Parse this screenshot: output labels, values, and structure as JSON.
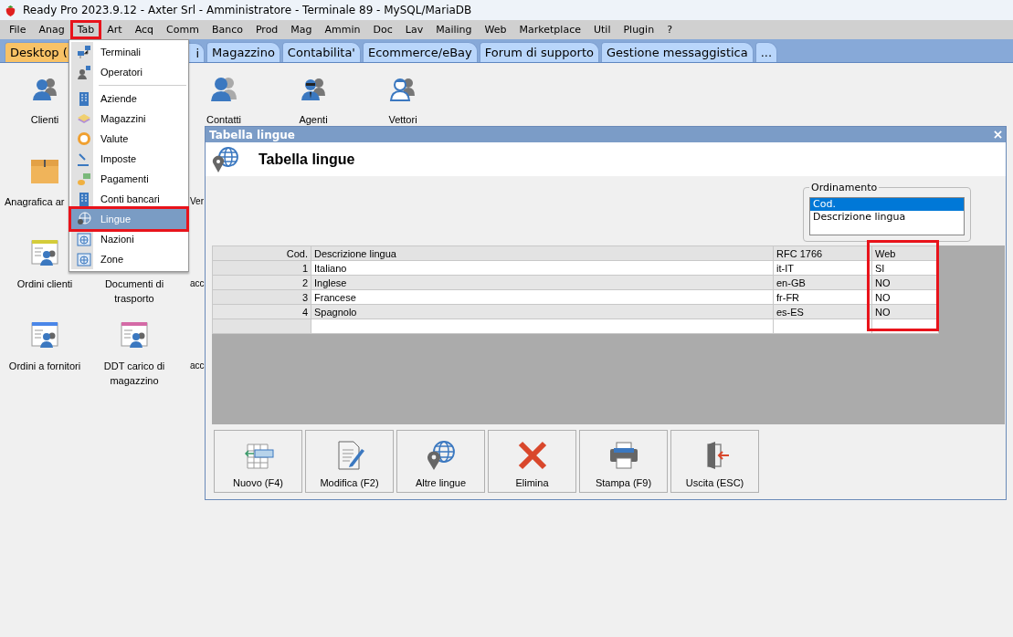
{
  "window": {
    "title": "Ready Pro 2023.9.12 - Axter Srl - Amministratore - Terminale 89 - MySQL/MariaDB"
  },
  "menu_bar": [
    {
      "label": "File",
      "highlighted": false
    },
    {
      "label": "Anag",
      "highlighted": false
    },
    {
      "label": "Tab",
      "highlighted": true
    },
    {
      "label": "Art",
      "highlighted": false
    },
    {
      "label": "Acq",
      "highlighted": false
    },
    {
      "label": "Comm",
      "highlighted": false
    },
    {
      "label": "Banco",
      "highlighted": false
    },
    {
      "label": "Prod",
      "highlighted": false
    },
    {
      "label": "Mag",
      "highlighted": false
    },
    {
      "label": "Ammin",
      "highlighted": false
    },
    {
      "label": "Doc",
      "highlighted": false
    },
    {
      "label": "Lav",
      "highlighted": false
    },
    {
      "label": "Mailing",
      "highlighted": false
    },
    {
      "label": "Web",
      "highlighted": false
    },
    {
      "label": "Marketplace",
      "highlighted": false
    },
    {
      "label": "Util",
      "highlighted": false
    },
    {
      "label": "Plugin",
      "highlighted": false
    },
    {
      "label": "?",
      "highlighted": false
    }
  ],
  "tabs": [
    {
      "label": "Desktop (",
      "selected": true
    },
    {
      "label": "i",
      "selected": false
    },
    {
      "label": "Magazzino",
      "selected": false
    },
    {
      "label": "Contabilita'",
      "selected": false
    },
    {
      "label": "Ecommerce/eBay",
      "selected": false
    },
    {
      "label": "Forum di supporto",
      "selected": false
    },
    {
      "label": "Gestione messaggistica",
      "selected": false
    },
    {
      "label": "...",
      "selected": false
    }
  ],
  "desktop": {
    "rows": [
      [
        {
          "label": "Clienti",
          "kind": "person"
        },
        null,
        {
          "label": "Contatti",
          "kind": "contacts"
        },
        {
          "label": "Agenti",
          "kind": "agent"
        },
        {
          "label": "Vettori",
          "kind": "courier"
        }
      ],
      [
        {
          "label": "Anagrafica ar",
          "kind": "box"
        },
        null,
        {
          "label": "Ver"
        },
        null,
        null
      ],
      [
        {
          "label": "Ordini clienti",
          "kind": "doc",
          "color": "#d4cc3a"
        },
        {
          "label": "Documenti di trasporto"
        },
        {
          "label": "acc"
        },
        null,
        null
      ],
      [
        {
          "label": "Ordini a fornitori",
          "kind": "doc",
          "color": "#4a86e8"
        },
        {
          "label": "DDT carico di magazzino",
          "kind": "doc",
          "color": "#d46aa6"
        },
        {
          "label": "acc"
        },
        null,
        null
      ]
    ]
  },
  "dropdown_menu": {
    "items": [
      {
        "label": "Terminali",
        "kind": "network",
        "selected": false,
        "highlighted": false
      },
      {
        "label": "Operatori",
        "kind": "operator",
        "selected": false,
        "highlighted": false
      },
      {
        "kind": "separator"
      },
      {
        "label": "Aziende",
        "kind": "building",
        "selected": false,
        "highlighted": false
      },
      {
        "label": "Magazzini",
        "kind": "stack",
        "selected": false,
        "highlighted": false
      },
      {
        "label": "Valute",
        "kind": "coin",
        "selected": false,
        "highlighted": false
      },
      {
        "label": "Imposte",
        "kind": "gavel",
        "selected": false,
        "highlighted": false
      },
      {
        "label": "Pagamenti",
        "kind": "money",
        "selected": false,
        "highlighted": false
      },
      {
        "label": "Conti bancari",
        "kind": "building",
        "selected": false,
        "highlighted": false
      },
      {
        "label": "Lingue",
        "kind": "globe",
        "selected": true,
        "highlighted": true
      },
      {
        "label": "Nazioni",
        "kind": "globe-window",
        "selected": false,
        "highlighted": false
      },
      {
        "label": "Zone",
        "kind": "globe-window",
        "selected": false,
        "highlighted": false
      }
    ]
  },
  "dialog": {
    "title": "Tabella lingue",
    "heading": "Tabella lingue",
    "sort_group": {
      "label": "Ordinamento",
      "options": [
        {
          "label": "Cod.",
          "selected": true
        },
        {
          "label": "Descrizione lingua",
          "selected": false
        }
      ]
    },
    "table": {
      "columns": [
        {
          "label": "Cod.",
          "highlighted": false
        },
        {
          "label": "Descrizione lingua",
          "highlighted": false
        },
        {
          "label": "RFC 1766",
          "highlighted": false
        },
        {
          "label": "Web",
          "highlighted": true
        }
      ],
      "rows": [
        [
          "1",
          "Italiano",
          "it-IT",
          "SI"
        ],
        [
          "2",
          "Inglese",
          "en-GB",
          "NO"
        ],
        [
          "3",
          "Francese",
          "fr-FR",
          "NO"
        ],
        [
          "4",
          "Spagnolo",
          "es-ES",
          "NO"
        ]
      ]
    },
    "buttons": [
      {
        "label": "Nuovo (F4)",
        "kind": "new"
      },
      {
        "label": "Modifica (F2)",
        "kind": "edit"
      },
      {
        "label": "Altre lingue",
        "kind": "globe"
      },
      {
        "label": "Elimina",
        "kind": "delete"
      },
      {
        "label": "Stampa (F9)",
        "kind": "print"
      },
      {
        "label": "Uscita (ESC)",
        "kind": "exit"
      }
    ]
  }
}
